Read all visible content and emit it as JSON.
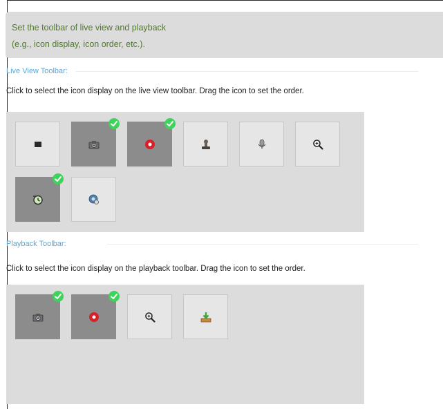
{
  "info": {
    "line1": "Set the toolbar of live view and playback",
    "line2": "(e.g., icon display, icon order, etc.)."
  },
  "live_view": {
    "title": "Live View Toolbar:",
    "instruction": "Click to select the icon display on the live view toolbar. Drag the icon to set the order.",
    "icons": [
      {
        "icon": "stop-icon",
        "selected": false
      },
      {
        "icon": "camera-snapshot-icon",
        "selected": true
      },
      {
        "icon": "record-icon",
        "selected": true
      },
      {
        "icon": "stamp-icon",
        "selected": false
      },
      {
        "icon": "microphone-icon",
        "selected": false
      },
      {
        "icon": "zoom-in-icon",
        "selected": false
      },
      {
        "icon": "instant-playback-icon",
        "selected": true
      },
      {
        "icon": "ptz-settings-icon",
        "selected": false
      }
    ]
  },
  "playback": {
    "title": "Playback Toolbar:",
    "instruction": "Click to select the icon display on the playback toolbar. Drag the icon to set the order.",
    "icons": [
      {
        "icon": "camera-snapshot-icon",
        "selected": true
      },
      {
        "icon": "record-icon",
        "selected": true
      },
      {
        "icon": "zoom-in-icon",
        "selected": false
      },
      {
        "icon": "download-icon",
        "selected": false
      }
    ]
  },
  "colors": {
    "hint_text": "#4f7a2a",
    "section_title": "#5aa6d6",
    "selected_tile": "#8c8c8c",
    "check_badge": "#3fd25c",
    "record_red": "#d8202a"
  }
}
